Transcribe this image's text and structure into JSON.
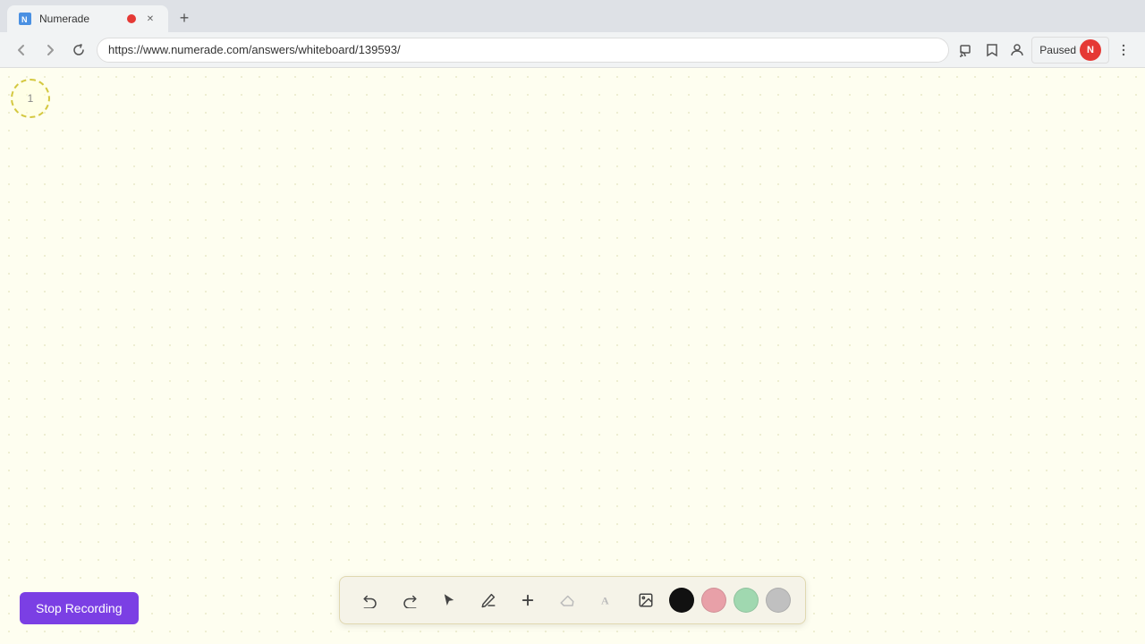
{
  "browser": {
    "title": "Numerade",
    "url": "https://www.numerade.com/answers/whiteboard/139593/",
    "recording_dot_visible": true,
    "paused_label": "Paused",
    "profile_initial": "N"
  },
  "tabs": [
    {
      "label": "Numerade",
      "active": true
    }
  ],
  "nav": {
    "back_label": "←",
    "forward_label": "→",
    "refresh_label": "↻",
    "new_tab_label": "+"
  },
  "toolbar": {
    "undo_label": "↺",
    "redo_label": "↻",
    "stop_recording_label": "Stop Recording"
  },
  "tools": [
    {
      "name": "undo",
      "icon": "↺",
      "label": "Undo"
    },
    {
      "name": "redo",
      "icon": "↻",
      "label": "Redo"
    },
    {
      "name": "select",
      "icon": "▲",
      "label": "Select"
    },
    {
      "name": "pen",
      "icon": "✎",
      "label": "Pen"
    },
    {
      "name": "add",
      "icon": "+",
      "label": "Add"
    },
    {
      "name": "eraser",
      "icon": "⌫",
      "label": "Eraser"
    },
    {
      "name": "text",
      "icon": "A",
      "label": "Text"
    },
    {
      "name": "image",
      "icon": "🖼",
      "label": "Image"
    }
  ],
  "colors": [
    {
      "name": "black",
      "value": "#111111"
    },
    {
      "name": "pink",
      "value": "#e8a0a8"
    },
    {
      "name": "mint",
      "value": "#a0d8b0"
    },
    {
      "name": "gray",
      "value": "#c0c0c0"
    }
  ],
  "page_number": "1",
  "whiteboard": {
    "background_color": "#fefef0"
  }
}
